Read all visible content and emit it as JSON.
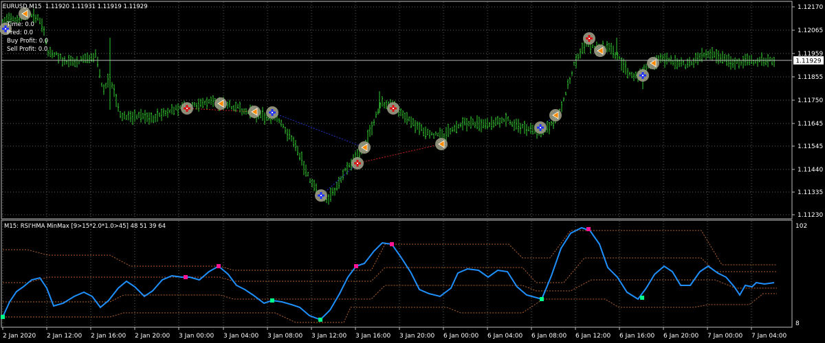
{
  "symbol_header": "EURUSD,M15  1.11920 1.11931 1.11919 1.11929",
  "info_lines": [
    "Time: 0.0",
    "Pred: 0.0",
    "Buy Profit: 0.0",
    "Sell Profit: 0.0"
  ],
  "price_axis": {
    "ticks": [
      "1.12170",
      "1.12065",
      "1.11959",
      "1.11855",
      "1.11750",
      "1.11645",
      "1.11545",
      "1.11440",
      "1.11335",
      "1.11230"
    ],
    "current_price": "1.11929"
  },
  "indicator": {
    "title": "M15: RSI'HMA MinMax [9>15*2.0*1.0>45] 48 51 39 64",
    "axis_top": "102",
    "axis_bottom": "8"
  },
  "time_axis": [
    "2 Jan 2020",
    "2 Jan 12:00",
    "2 Jan 16:00",
    "2 Jan 20:00",
    "3 Jan 00:00",
    "3 Jan 04:00",
    "3 Jan 08:00",
    "3 Jan 12:00",
    "3 Jan 16:00",
    "3 Jan 20:00",
    "6 Jan 00:00",
    "6 Jan 04:00",
    "6 Jan 08:00",
    "6 Jan 12:00",
    "6 Jan 16:00",
    "6 Jan 20:00",
    "7 Jan 00:00",
    "7 Jan 04:00"
  ],
  "colors": {
    "background": "#000000",
    "candles": "#32cd32",
    "grid": "#5a6a5a",
    "axis_line": "#c0c0c0",
    "indicator_line": "#1e90ff",
    "band_line": "#b8642e",
    "marker_buy": "#00ff88",
    "marker_sell": "#ff1493",
    "trade_buy_line": "#2233cc",
    "trade_sell_line": "#cc2222"
  },
  "trade_arrows": [
    {
      "kind": "sell-exit",
      "icon": "left-arrow-icon"
    },
    {
      "kind": "buy-entry",
      "icon": "plus-icon"
    },
    {
      "kind": "sell-entry",
      "icon": "plus-icon"
    },
    {
      "kind": "sell-exit",
      "icon": "left-arrow-icon"
    }
  ]
}
